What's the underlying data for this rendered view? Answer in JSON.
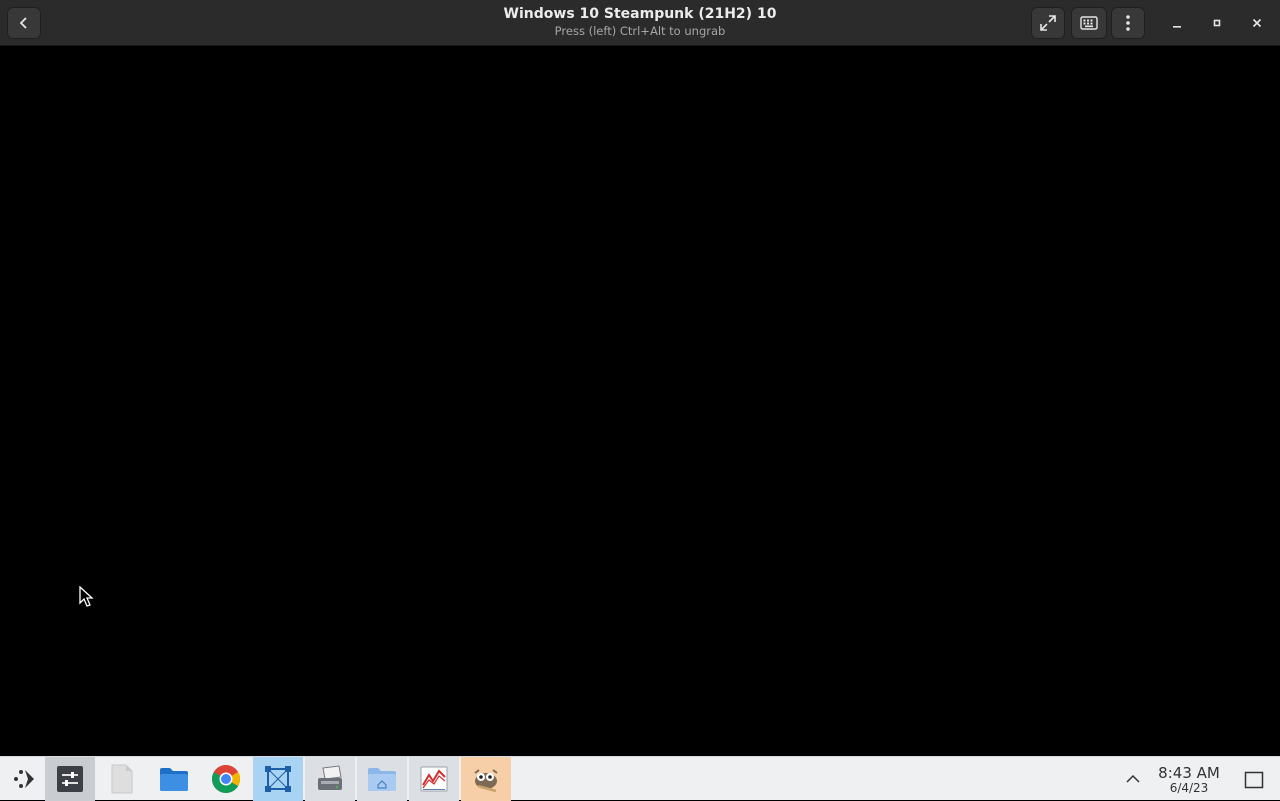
{
  "window": {
    "title": "Windows 10 Steampunk (21H2) 10",
    "subtitle": "Press (left) Ctrl+Alt to ungrab"
  },
  "toolbar": {
    "icons": [
      "back-icon",
      "fullscreen-icon",
      "keyboard-icon",
      "kebab-menu-icon",
      "minimize-icon",
      "maximize-icon",
      "close-icon"
    ]
  },
  "taskbar": {
    "apps": [
      {
        "name": "launcher",
        "icon": "launcher-icon"
      },
      {
        "name": "virtual-machines",
        "icon": "boxes-icon"
      },
      {
        "name": "files-blank",
        "icon": "document-icon"
      },
      {
        "name": "file-manager",
        "icon": "folder-icon"
      },
      {
        "name": "chrome",
        "icon": "chrome-icon"
      },
      {
        "name": "screenshot-tool",
        "icon": "crop-frame-icon"
      },
      {
        "name": "scanner",
        "icon": "scanner-icon"
      },
      {
        "name": "home-folder",
        "icon": "home-folder-icon"
      },
      {
        "name": "system-monitor",
        "icon": "graph-icon"
      },
      {
        "name": "gimp",
        "icon": "gimp-icon"
      }
    ],
    "clock": {
      "time": "8:43 AM",
      "date": "6/4/23"
    }
  },
  "colors": {
    "titlebar": "#2b2b2b",
    "taskbar": "#eef0f2",
    "vm_background": "#000000"
  }
}
